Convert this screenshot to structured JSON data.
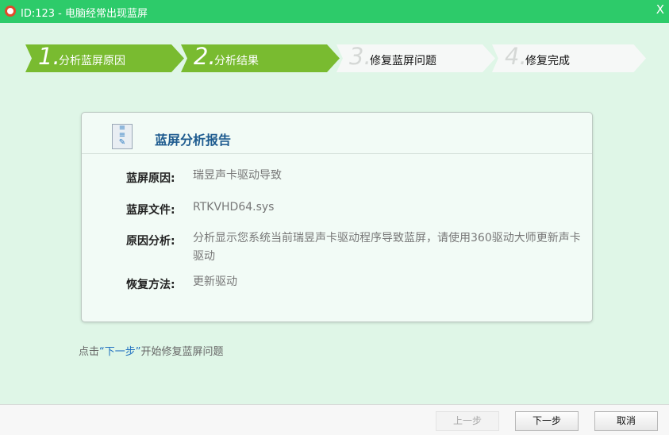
{
  "window": {
    "title": "ID:123 - 电脑经常出现蓝屏",
    "close": "X"
  },
  "steps": [
    {
      "num": "1.",
      "label": "分析蓝屏原因"
    },
    {
      "num": "2.",
      "label": "分析结果"
    },
    {
      "num": "3.",
      "label": "修复蓝屏问题"
    },
    {
      "num": "4.",
      "label": "修复完成"
    }
  ],
  "report": {
    "title": "蓝屏分析报告",
    "rows": [
      {
        "key": "蓝屏原因:",
        "value": "瑞昱声卡驱动导致"
      },
      {
        "key": "蓝屏文件:",
        "value": "RTKVHD64.sys"
      },
      {
        "key": "原因分析:",
        "value": "分析显示您系统当前瑞昱声卡驱动程序导致蓝屏，请使用360驱动大师更新声卡驱动"
      },
      {
        "key": "恢复方法:",
        "value": "更新驱动"
      }
    ]
  },
  "hint": {
    "pre": "点击",
    "quoted": "“下一步”",
    "post": "开始修复蓝屏问题"
  },
  "buttons": {
    "prev": "上一步",
    "next": "下一步",
    "cancel": "取消"
  }
}
